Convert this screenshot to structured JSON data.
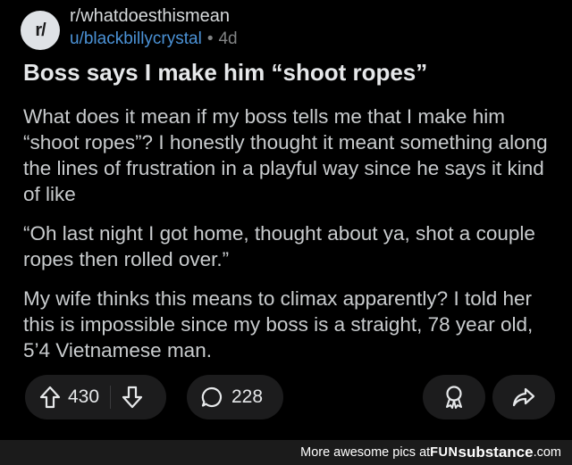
{
  "post": {
    "subreddit_icon": "r/",
    "subreddit": "r/whatdoesthismean",
    "username": "u/blackbillycrystal",
    "separator": "•",
    "age": "4d",
    "title": "Boss says I make him “shoot ropes”",
    "paragraphs": [
      "What does it mean if my boss tells me that I make him “shoot ropes”? I honestly thought it meant something along the lines of frustration in a playful way since he says it kind of like",
      "“Oh last night I got home, thought about ya, shot a couple ropes then rolled over.”",
      "My wife thinks this means to climax apparently? I told her this is impossible since my boss is a straight, 78 year old, 5’4 Vietnamese man."
    ]
  },
  "actions": {
    "upvote_icon": "upvote-arrow-icon",
    "score": "430",
    "downvote_icon": "downvote-arrow-icon",
    "comment_icon": "comment-bubble-icon",
    "comments": "228",
    "award_icon": "award-icon",
    "share_icon": "share-icon"
  },
  "footer": {
    "text": "More awesome pics at ",
    "brand_fun": "FUN",
    "brand_sub": "substance",
    "brand_com": ".com"
  },
  "colors": {
    "background": "#000000",
    "username": "#4b92d6",
    "pill": "#1c1c1d",
    "footer_bg": "#1b1b1b"
  }
}
